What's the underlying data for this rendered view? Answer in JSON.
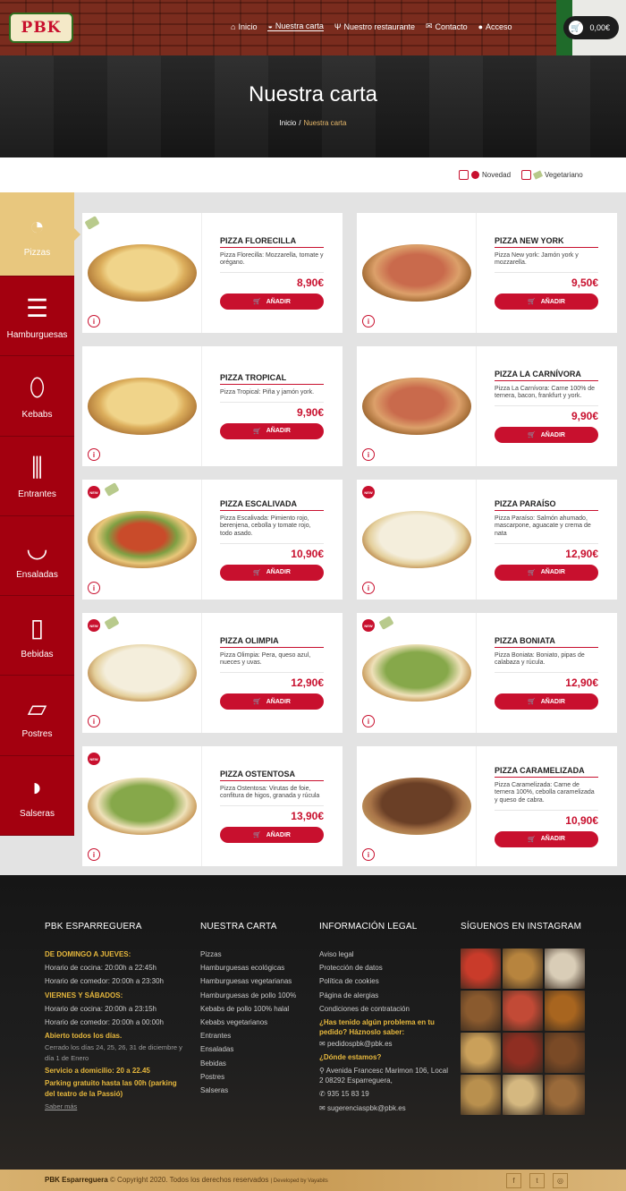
{
  "header": {
    "logo_text": "PBK",
    "nav": [
      {
        "icon": "home-icon",
        "glyph": "⌂",
        "label": "Inicio"
      },
      {
        "icon": "menu-icon",
        "glyph": "◒",
        "label": "Nuestra carta"
      },
      {
        "icon": "cutlery-icon",
        "glyph": "Ψ",
        "label": "Nuestro restaurante"
      },
      {
        "icon": "mail-icon",
        "glyph": "✉",
        "label": "Contacto"
      },
      {
        "icon": "user-icon",
        "glyph": "●",
        "label": "Acceso"
      }
    ],
    "cart_total": "0,00€"
  },
  "hero": {
    "title": "Nuestra carta",
    "breadcrumb_home": "Inicio",
    "breadcrumb_sep": "/",
    "breadcrumb_current": "Nuestra carta"
  },
  "filters": {
    "new_label": "Novedad",
    "veg_label": "Vegetariano"
  },
  "categories": [
    {
      "label": "Pizzas",
      "icon": "pizza-icon",
      "glyph": "◔"
    },
    {
      "label": "Hamburguesas",
      "icon": "burger-icon",
      "glyph": "☰"
    },
    {
      "label": "Kebabs",
      "icon": "kebab-icon",
      "glyph": "⬯"
    },
    {
      "label": "Entrantes",
      "icon": "fries-icon",
      "glyph": "⫼"
    },
    {
      "label": "Ensaladas",
      "icon": "salad-icon",
      "glyph": "◡"
    },
    {
      "label": "Bebidas",
      "icon": "drink-icon",
      "glyph": "▯"
    },
    {
      "label": "Postres",
      "icon": "cake-icon",
      "glyph": "▱"
    },
    {
      "label": "Salseras",
      "icon": "sauce-boat-icon",
      "glyph": "◗"
    }
  ],
  "products": [
    {
      "name": "PIZZA FLORECILLA",
      "desc": "Pizza Florecilla: Mozzarella, tomate y orégano.",
      "price": "8,90€",
      "new": false,
      "veg": true
    },
    {
      "name": "PIZZA NEW YORK",
      "desc": "Pizza New york: Jamón york y mozzarella.",
      "price": "9,50€",
      "new": false,
      "veg": false
    },
    {
      "name": "PIZZA TROPICAL",
      "desc": "Pizza Tropical: Piña y jamón york.",
      "price": "9,90€",
      "new": false,
      "veg": false
    },
    {
      "name": "PIZZA LA CARNÍVORA",
      "desc": "Pizza La Carnívora: Carne 100% de ternera, bacon, frankfurt y york.",
      "price": "9,90€",
      "new": false,
      "veg": false
    },
    {
      "name": "PIZZA ESCALIVADA",
      "desc": "Pizza Escalivada: Pimiento rojo, berenjena, cebolla y tomate rojo, todo asado.",
      "price": "10,90€",
      "new": true,
      "veg": true
    },
    {
      "name": "PIZZA PARAÍSO",
      "desc": "Pizza Paraíso: Salmón ahumado, mascarpone, aguacate y crema de nata",
      "price": "12,90€",
      "new": true,
      "veg": false
    },
    {
      "name": "PIZZA OLIMPIA",
      "desc": "Pizza Olimpia: Pera, queso azul, nueces y uvas.",
      "price": "12,90€",
      "new": true,
      "veg": true
    },
    {
      "name": "PIZZA BONIATA",
      "desc": "Pizza Boniata: Boniato, pipas de calabaza y rúcula.",
      "price": "12,90€",
      "new": true,
      "veg": true
    },
    {
      "name": "PIZZA OSTENTOSA",
      "desc": "Pizza Ostentosa: Virutas de foie, confitura de higos, granada y rúcula",
      "price": "13,90€",
      "new": true,
      "veg": false
    },
    {
      "name": "PIZZA CARAMELIZADA",
      "desc": "Pizza Caramelizada: Carne de ternera 100%, cebolla caramelizada y queso de cabra.",
      "price": "10,90€",
      "new": false,
      "veg": false
    }
  ],
  "add_label": "AÑADIR",
  "new_badge": "NEW",
  "info_glyph": "i",
  "cart_glyph": "🛒",
  "footer": {
    "col1": {
      "title": "PBK ESPARREGUERA",
      "lines": [
        {
          "t": "DE DOMINGO A JUEVES:",
          "c": "hl"
        },
        {
          "t": "Horario de cocina: 20:00h a 22:45h",
          "c": ""
        },
        {
          "t": "Horario de comedor: 20:00h a 23:30h",
          "c": ""
        },
        {
          "t": "VIERNES Y SÁBADOS:",
          "c": "hl"
        },
        {
          "t": "Horario de cocina: 20:00h a 23:15h",
          "c": ""
        },
        {
          "t": "Horario de comedor: 20:00h a 00:00h",
          "c": ""
        },
        {
          "t": "Abierto todos los días.",
          "c": "hl"
        },
        {
          "t": "Cerrado los días 24, 25, 26, 31 de diciembre y día 1 de Enero",
          "c": "muted"
        },
        {
          "t": "Servicio a domicilio: 20 a 22.45",
          "c": "mixed"
        },
        {
          "t": "Parking gratuito hasta las 00h (parking del teatro de la Passió)",
          "c": "mixed2"
        },
        {
          "t": "Saber más",
          "c": "link"
        }
      ]
    },
    "col2": {
      "title": "NUESTRA CARTA",
      "items": [
        "Pizzas",
        "Hamburguesas ecológicas",
        "Hamburguesas vegetarianas",
        "Hamburguesas de pollo 100%",
        "Kebabs de pollo 100% halal",
        "Kebabs vegetarianos",
        "Entrantes",
        "Ensaladas",
        "Bebidas",
        "Postres",
        "Salseras"
      ]
    },
    "col3": {
      "title": "INFORMACIÓN LEGAL",
      "items": [
        "Aviso legal",
        "Protección de datos",
        "Política de cookies",
        "Página de alergias",
        "Condiciones de contratación"
      ],
      "problem_q": "¿Has tenido algún problema en tu pedido? Háznoslo saber:",
      "problem_mail": "pedidospbk@pbk.es",
      "where_q": "¿Dónde estamos?",
      "address": "Avenida Francesc Marimon 106, Local 2 08292 Esparreguera,",
      "phone": "935 15 83 19",
      "suggest_mail": "sugerenciaspbk@pbk.es"
    },
    "col4": {
      "title": "SÍGUENOS EN INSTAGRAM",
      "tiles": [
        "#c93b2a",
        "#b7843e",
        "#d9cdb7",
        "#8a5a2e",
        "#c24a36",
        "#a8651f",
        "#caa05a",
        "#8f2e22",
        "#7a4a26",
        "#b9904e",
        "#d5b880",
        "#9a6a3a"
      ]
    },
    "copyright_brand": "PBK Esparreguera",
    "copyright_text": "© Copyright 2020. Todos los derechos reservados",
    "developed": "| Developed by Vayabits",
    "social": [
      {
        "icon": "facebook-icon",
        "glyph": "f"
      },
      {
        "icon": "twitter-icon",
        "glyph": "t"
      },
      {
        "icon": "instagram-icon",
        "glyph": "◎"
      }
    ]
  },
  "colors": {
    "accent": "#c8102e",
    "sidebar": "#a3000f",
    "sidebar_active": "#e8c77e",
    "footer_highlight": "#e7b83d"
  }
}
